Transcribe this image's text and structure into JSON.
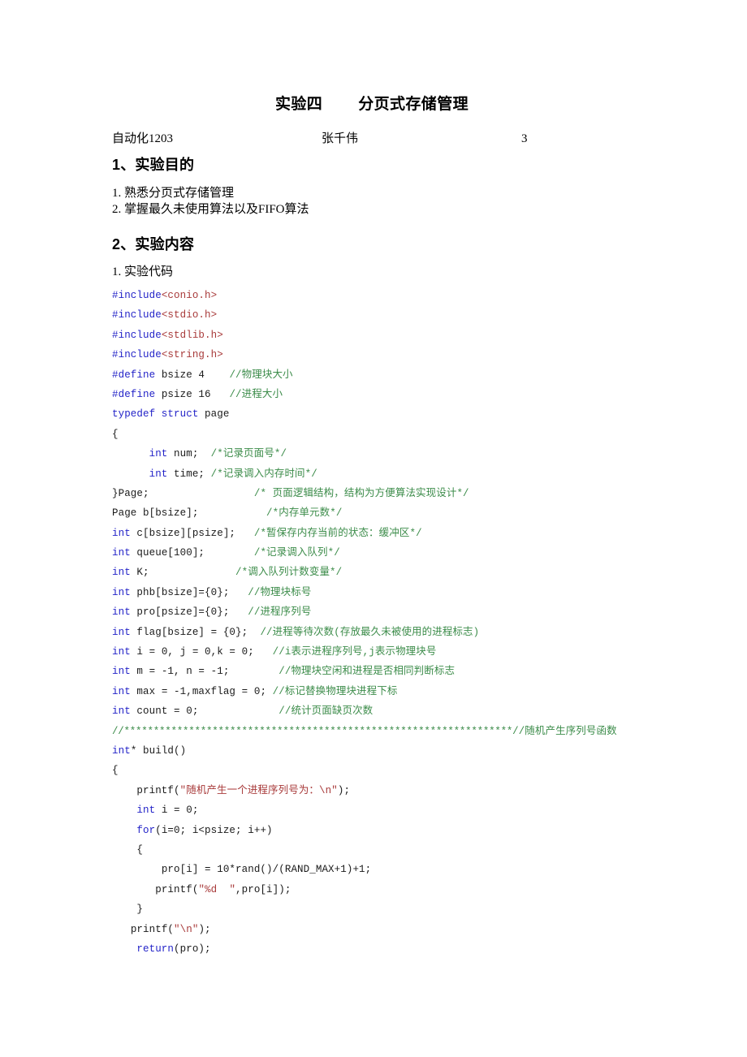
{
  "document": {
    "title_part1": "实验四",
    "title_part2": "分页式存储管理",
    "info": {
      "class": "自动化1203",
      "name": "张千伟",
      "number": "3"
    },
    "sections": [
      {
        "heading": "1、实验目的",
        "lines": [
          "1. 熟悉分页式存储管理",
          "2. 掌握最久未使用算法以及FIFO算法"
        ]
      },
      {
        "heading": "2、实验内容",
        "lines": [
          "1. 实验代码"
        ]
      }
    ],
    "colors": {
      "keyword": "#2323c8",
      "string": "#a83a3a",
      "comment": "#3c8c4a",
      "plain": "#1a1a1a",
      "background": "#ffffff"
    },
    "code_lines": [
      {
        "kw": "#include",
        "str": "<conio.h>"
      },
      {
        "kw": "#include",
        "str": "<stdio.h>"
      },
      {
        "kw": "#include",
        "str": "<stdlib.h>"
      },
      {
        "kw": "#include",
        "str": "<string.h>"
      },
      {
        "kw": "#define",
        "pln": " bsize 4",
        "pad": "    ",
        "cmt": "//物理块大小"
      },
      {
        "kw": "#define",
        "pln": " psize 16",
        "pad": "   ",
        "cmt": "//进程大小"
      },
      {
        "kw": "typedef struct",
        "pln": " page"
      },
      {
        "pln": "{"
      },
      {
        "indent": "      ",
        "kw": "int",
        "pln": " num;",
        "pad": "  ",
        "cmt": "/*记录页面号*/"
      },
      {
        "indent": "      ",
        "kw": "int",
        "pln": " time;",
        "pad": " ",
        "cmt": "/*记录调入内存时间*/"
      },
      {
        "pln": "}Page;",
        "pad": "                 ",
        "cmt": "/* 页面逻辑结构，结构为方便算法实现设计*/"
      },
      {
        "pln": "Page b[bsize];",
        "pad": "           ",
        "cmt": "/*内存单元数*/"
      },
      {
        "kw": "int",
        "pln": " c[bsize][psize];",
        "pad": "   ",
        "cmt": "/*暂保存内存当前的状态：缓冲区*/"
      },
      {
        "kw": "int",
        "pln": " queue[100];",
        "pad": "        ",
        "cmt": "/*记录调入队列*/"
      },
      {
        "kw": "int",
        "pln": " K;",
        "pad": "              ",
        "cmt": "/*调入队列计数变量*/"
      },
      {
        "kw": "int",
        "pln": " phb[bsize]={0};",
        "pad": "   ",
        "cmt": "//物理块标号"
      },
      {
        "kw": "int",
        "pln": " pro[psize]={0};",
        "pad": "   ",
        "cmt": "//进程序列号"
      },
      {
        "kw": "int",
        "pln": " flag[bsize] = {0};",
        "pad": "  ",
        "cmt": "//进程等待次数(存放最久未被使用的进程标志)"
      },
      {
        "kw": "int",
        "pln": " i = 0, j = 0,k = 0;",
        "pad": "   ",
        "cmt": "//i表示进程序列号,j表示物理块号"
      },
      {
        "kw": "int",
        "pln": " m = -1, n = -1;",
        "pad": "        ",
        "cmt": "//物理块空闲和进程是否相同判断标志"
      },
      {
        "kw": "int",
        "pln": " max = -1,maxflag = 0;",
        "pad": " ",
        "cmt": "//标记替换物理块进程下标"
      },
      {
        "kw": "int",
        "pln": " count = 0;",
        "pad": "             ",
        "cmt": "//统计页面缺页次数"
      },
      {
        "stars": "//******************************************************************",
        "cmt_tail": "//随机产生序列号函数"
      },
      {
        "kw": "int",
        "pln": "* build()"
      },
      {
        "pln": "{"
      },
      {
        "indent": "    ",
        "pln": "printf(",
        "str": "\"随机产生一个进程序列号为：\\n\"",
        "pln2": ");"
      },
      {
        "indent": "    ",
        "kw": "int",
        "pln": " i = 0;"
      },
      {
        "indent": "    ",
        "kw": "for",
        "pln": "(i=0; i<psize; i++)"
      },
      {
        "indent": "    ",
        "pln": "{"
      },
      {
        "indent": "        ",
        "pln": "pro[i] = 10*rand()/(RAND_MAX+1)+1;"
      },
      {
        "indent": "       ",
        "pln": "printf(",
        "str": "\"%d  \"",
        "pln2": ",pro[i]);"
      },
      {
        "indent": "    ",
        "pln": "}"
      },
      {
        "indent": "   ",
        "pln": "printf(",
        "str": "\"\\n\"",
        "pln2": ");"
      },
      {
        "indent": "    ",
        "kw": "return",
        "pln": "(pro);"
      }
    ]
  }
}
